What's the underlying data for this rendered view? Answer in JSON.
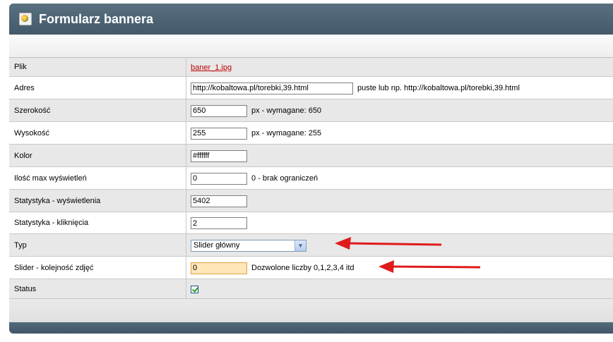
{
  "header": {
    "title": "Formularz bannera",
    "icon": "image-icon"
  },
  "form": {
    "file_label": "Plik",
    "file_link": "baner_1.jpg",
    "address_label": "Adres",
    "address_value": "http://kobaltowa.pl/torebki,39.html",
    "address_hint": "puste lub np. http://kobaltowa.pl/torebki,39.html",
    "width_label": "Szerokość",
    "width_value": "650",
    "width_hint": "px - wymagane: 650",
    "height_label": "Wysokość",
    "height_value": "255",
    "height_hint": "px - wymagane: 255",
    "color_label": "Kolor",
    "color_value": "#ffffff",
    "maxviews_label": "Ilość max wyświetleń",
    "maxviews_value": "0",
    "maxviews_hint": "0 - brak ograniczeń",
    "stat_views_label": "Statystyka - wyświetlenia",
    "stat_views_value": "5402",
    "stat_clicks_label": "Statystyka - kliknięcia",
    "stat_clicks_value": "2",
    "type_label": "Typ",
    "type_value": "Slider główny",
    "order_label": "Slider - kolejność zdjęć",
    "order_value": "0",
    "order_hint": "Dozwolone liczby 0,1,2,3,4 itd",
    "status_label": "Status",
    "status_checked": true
  },
  "colors": {
    "title_bar": "#4b6172",
    "link": "#c00000",
    "arrow": "#e01b1b",
    "focus_bg": "#ffe7b8"
  }
}
